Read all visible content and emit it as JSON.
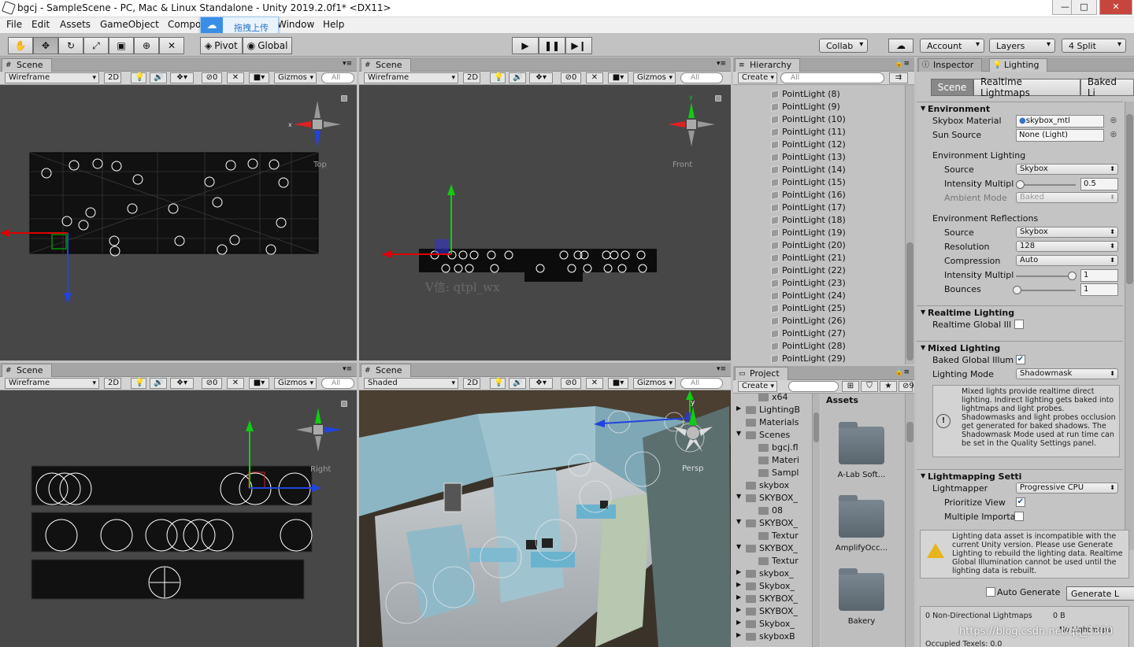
{
  "window": {
    "title": "bgcj - SampleScene - PC, Mac & Linux Standalone - Unity 2019.2.0f1* <DX11>",
    "controls": {
      "minimize": "—",
      "maximize": "□",
      "close": "✕"
    }
  },
  "menu": [
    "File",
    "Edit",
    "Assets",
    "GameObject",
    "Compo",
    "Window",
    "Help"
  ],
  "upload_popup": {
    "label": "拖拽上传"
  },
  "toolbar": {
    "pivot": "Pivot",
    "global": "Global",
    "collab": "Collab",
    "account": "Account",
    "layers": "Layers",
    "layout": "4 Split"
  },
  "scene_views": [
    {
      "tab": "Scene",
      "mode": "Wireframe",
      "two_d": "2D",
      "hidden": "0",
      "gizmos": "Gizmos",
      "search": "All",
      "view_label": "Top"
    },
    {
      "tab": "Scene",
      "mode": "Wireframe",
      "two_d": "2D",
      "hidden": "0",
      "gizmos": "Gizmos",
      "search": "All",
      "view_label": "Front",
      "watermark": "V信: qtpl_wx"
    },
    {
      "tab": "Scene",
      "mode": "Wireframe",
      "two_d": "2D",
      "hidden": "0",
      "gizmos": "Gizmos",
      "search": "All",
      "view_label": "Right"
    },
    {
      "tab": "Scene",
      "mode": "Shaded",
      "two_d": "2D",
      "hidden": "0",
      "gizmos": "Gizmos",
      "search": "All",
      "view_label": "Persp"
    }
  ],
  "hierarchy": {
    "tab": "Hierarchy",
    "create": "Create",
    "search": "All",
    "items": [
      "PointLight (8)",
      "PointLight (9)",
      "PointLight (10)",
      "PointLight (11)",
      "PointLight (12)",
      "PointLight (13)",
      "PointLight (14)",
      "PointLight (15)",
      "PointLight (16)",
      "PointLight (17)",
      "PointLight (18)",
      "PointLight (19)",
      "PointLight (20)",
      "PointLight (21)",
      "PointLight (22)",
      "PointLight (23)",
      "PointLight (24)",
      "PointLight (25)",
      "PointLight (26)",
      "PointLight (27)",
      "PointLight (28)",
      "PointLight (29)"
    ]
  },
  "project": {
    "tab": "Project",
    "create": "Create",
    "tree": [
      {
        "name": "x64",
        "indent": 2,
        "arrow": ""
      },
      {
        "name": "LightingB",
        "indent": 1,
        "arrow": "▶"
      },
      {
        "name": "Materials",
        "indent": 1,
        "arrow": ""
      },
      {
        "name": "Scenes",
        "indent": 1,
        "arrow": "▼"
      },
      {
        "name": "bgcj.fl",
        "indent": 2,
        "arrow": ""
      },
      {
        "name": "Materi",
        "indent": 2,
        "arrow": ""
      },
      {
        "name": "Sampl",
        "indent": 2,
        "arrow": ""
      },
      {
        "name": "skybox",
        "indent": 1,
        "arrow": ""
      },
      {
        "name": "SKYBOX_",
        "indent": 1,
        "arrow": "▼"
      },
      {
        "name": "08",
        "indent": 2,
        "arrow": ""
      },
      {
        "name": "SKYBOX_",
        "indent": 1,
        "arrow": "▼"
      },
      {
        "name": "Textur",
        "indent": 2,
        "arrow": ""
      },
      {
        "name": "SKYBOX_",
        "indent": 1,
        "arrow": "▼"
      },
      {
        "name": "Textur",
        "indent": 2,
        "arrow": ""
      },
      {
        "name": "skybox_",
        "indent": 1,
        "arrow": "▶"
      },
      {
        "name": "Skybox_",
        "indent": 1,
        "arrow": "▶"
      },
      {
        "name": "SKYBOX_",
        "indent": 1,
        "arrow": "▶"
      },
      {
        "name": "SKYBOX_",
        "indent": 1,
        "arrow": "▶"
      },
      {
        "name": "Skybox_",
        "indent": 1,
        "arrow": "▶"
      },
      {
        "name": "skyboxB",
        "indent": 1,
        "arrow": "▶"
      }
    ],
    "assets_title": "Assets",
    "assets": [
      "A-Lab Soft...",
      "AmplifyOcc...",
      "Bakery"
    ],
    "count": "9"
  },
  "inspector": {
    "tabs": [
      "Inspector",
      "Lighting"
    ],
    "subtabs": [
      "Scene",
      "Realtime Lightmaps",
      "Baked Li"
    ],
    "environment": {
      "title": "Environment",
      "skybox_material_label": "Skybox Material",
      "skybox_material_value": "skybox_mtl",
      "sun_source_label": "Sun Source",
      "sun_source_value": "None (Light)",
      "env_lighting_title": "Environment Lighting",
      "source_label": "Source",
      "source_value": "Skybox",
      "intensity_label": "Intensity Multipl",
      "intensity_value": "0.5",
      "intensity_fraction": 0.0,
      "ambient_mode_label": "Ambient Mode",
      "ambient_mode_value": "Baked",
      "env_reflections_title": "Environment Reflections",
      "refl_source_label": "Source",
      "refl_source_value": "Skybox",
      "resolution_label": "Resolution",
      "resolution_value": "128",
      "compression_label": "Compression",
      "compression_value": "Auto",
      "refl_intensity_label": "Intensity Multipl",
      "refl_intensity_value": "1",
      "bounces_label": "Bounces",
      "bounces_value": "1"
    },
    "realtime": {
      "title": "Realtime Lighting",
      "gi_label": "Realtime Global Ill",
      "gi_checked": false
    },
    "mixed": {
      "title": "Mixed Lighting",
      "baked_gi_label": "Baked Global Illum",
      "baked_gi_checked": true,
      "mode_label": "Lighting Mode",
      "mode_value": "Shadowmask",
      "help": "Mixed lights provide realtime direct lighting. Indirect lighting gets baked into lightmaps and light probes. Shadowmasks and light probes occlusion get generated for baked shadows. The Shadowmask Mode used at run time can be set in the Quality Settings panel."
    },
    "lightmapping": {
      "title": "Lightmapping Setti",
      "lightmapper_label": "Lightmapper",
      "lightmapper_value": "Progressive CPU",
      "prioritize_label": "Prioritize View",
      "prioritize_checked": true,
      "multiple_label": "Multiple Importa",
      "multiple_checked": false
    },
    "warning": "Lighting data asset is incompatible with the current Unity version.  Please use Generate Lighting to rebuild the lighting data. Realtime Global Illumination cannot be used until the lighting data is rebuilt.",
    "auto_generate_label": "Auto Generate",
    "generate_label": "Generate L",
    "stats": {
      "row1_label": "0 Non-Directional Lightmaps",
      "row1_value": "0 B",
      "row2_value": "No Lightmaps",
      "row3_label": "Occupied Texels: 0.0"
    }
  },
  "watermark": "https://blog.csdn.net/qq_3300"
}
